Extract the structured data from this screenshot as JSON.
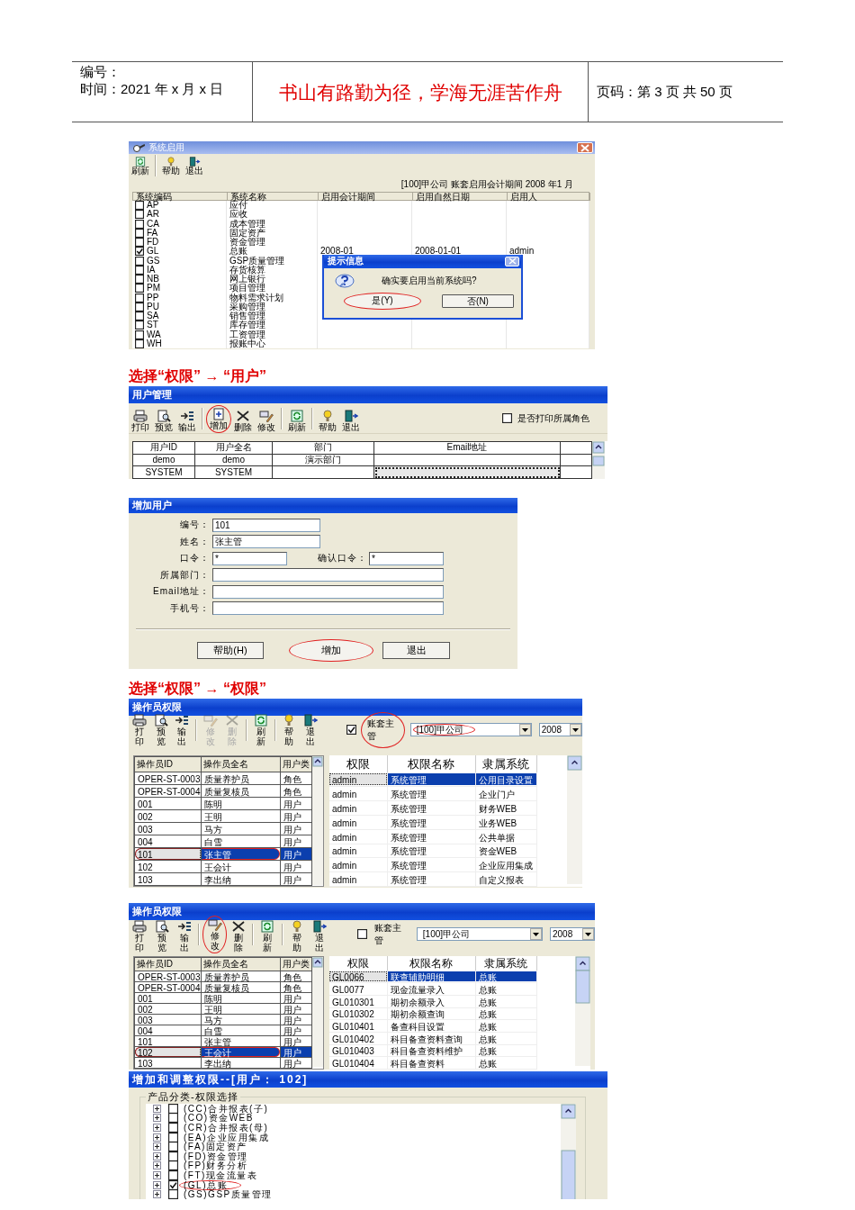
{
  "header": {
    "number_label": "编号：",
    "date": "时间：2021 年 x 月 x 日",
    "motto": "书山有路勤为径，学海无涯苦作舟",
    "page": "页码：第 3 页  共 50 页"
  },
  "system_enable": {
    "title": "系统启用",
    "toolbar": [
      [
        {
          "kind": "refresh",
          "label": "刷新"
        }
      ],
      [
        {
          "kind": "help",
          "label": "帮助"
        },
        {
          "kind": "exit",
          "label": "退出"
        }
      ]
    ],
    "info": "[100]甲公司 账套启用会计期间 2008 年1 月",
    "columns": [
      "系统编码",
      "系统名称",
      "启用会计期间",
      "启用自然日期",
      "启用人"
    ],
    "rows": [
      {
        "code": "AP",
        "name": "应付",
        "checked": false
      },
      {
        "code": "AR",
        "name": "应收",
        "checked": false
      },
      {
        "code": "CA",
        "name": "成本管理",
        "checked": false
      },
      {
        "code": "FA",
        "name": "固定资产",
        "checked": false
      },
      {
        "code": "FD",
        "name": "资金管理",
        "checked": false
      },
      {
        "code": "GL",
        "name": "总账",
        "period": "2008-01",
        "date": "2008-01-01",
        "user": "admin",
        "checked": true
      },
      {
        "code": "GS",
        "name": "GSP质量管理",
        "checked": false
      },
      {
        "code": "IA",
        "name": "存货核算",
        "checked": false
      },
      {
        "code": "NB",
        "name": "网上银行",
        "checked": false
      },
      {
        "code": "PM",
        "name": "项目管理",
        "checked": false
      },
      {
        "code": "PP",
        "name": "物料需求计划",
        "checked": false
      },
      {
        "code": "PU",
        "name": "采购管理",
        "checked": false
      },
      {
        "code": "SA",
        "name": "销售管理",
        "checked": false
      },
      {
        "code": "ST",
        "name": "库存管理",
        "checked": false
      },
      {
        "code": "WA",
        "name": "工资管理",
        "checked": false
      },
      {
        "code": "WH",
        "name": "报账中心",
        "checked": false
      }
    ],
    "dialog": {
      "title": "提示信息",
      "message": "确实要启用当前系统吗?",
      "buttons": [
        {
          "label": "是(Y)",
          "highlighted": true
        },
        {
          "label": "否(N)",
          "highlighted": false
        }
      ]
    }
  },
  "caption_1": "选择“权限” → “用户”",
  "user_management": {
    "title": "用户管理",
    "toolbar": [
      [
        {
          "kind": "print",
          "label": "打印",
          "highlighted": false
        },
        {
          "kind": "preview",
          "label": "预览",
          "highlighted": false
        },
        {
          "kind": "export",
          "label": "输出",
          "highlighted": false
        }
      ],
      [
        {
          "kind": "add",
          "label": "增加",
          "highlighted": true
        },
        {
          "kind": "delete",
          "label": "删除",
          "highlighted": false
        },
        {
          "kind": "edit",
          "label": "修改",
          "highlighted": false
        }
      ],
      [
        {
          "kind": "refresh",
          "label": "刷新",
          "highlighted": false
        }
      ],
      [
        {
          "kind": "help",
          "label": "帮助",
          "highlighted": false
        },
        {
          "kind": "exit",
          "label": "退出",
          "highlighted": false
        }
      ]
    ],
    "print_roles": {
      "label": "是否打印所属角色",
      "checked": false
    },
    "columns": [
      "用户ID",
      "用户全名",
      "部门",
      "Email地址"
    ],
    "rows": [
      {
        "id": "demo",
        "name": "demo",
        "department": "演示部门",
        "selected": false
      },
      {
        "id": "SYSTEM",
        "name": "SYSTEM",
        "selected": true
      }
    ]
  },
  "add_user": {
    "title": "增加用户",
    "fields": [
      {
        "label": "编号：",
        "value": "101",
        "kind": "short"
      },
      {
        "label": "姓名：",
        "value": "张主管",
        "kind": "short"
      },
      {
        "label": "口令：",
        "value": "*",
        "kind": "narrow",
        "pair": {
          "label": "确认口令：",
          "value": "*"
        }
      },
      {
        "label": "所属部门：",
        "kind": "long"
      },
      {
        "label": "Email地址：",
        "kind": "long"
      },
      {
        "label": "手机号：",
        "kind": "long"
      }
    ],
    "buttons": [
      {
        "label": "帮助(H)",
        "highlighted": false
      },
      {
        "label": "增加",
        "highlighted": true
      },
      {
        "label": "退出",
        "highlighted": false
      }
    ]
  },
  "caption_2": "选择“权限” → “权限”",
  "operator_rights_1": {
    "title": "操作员权限",
    "toolbar": [
      [
        {
          "kind": "print",
          "label": "打印",
          "disabled": false
        },
        {
          "kind": "preview",
          "label": "预览",
          "disabled": false
        },
        {
          "kind": "export",
          "label": "输出",
          "disabled": false
        }
      ],
      [
        {
          "kind": "edit",
          "label": "修改",
          "disabled": true
        },
        {
          "kind": "delete",
          "label": "删除",
          "disabled": true
        }
      ],
      [
        {
          "kind": "refresh",
          "label": "刷新",
          "disabled": false
        }
      ],
      [
        {
          "kind": "help",
          "label": "帮助",
          "disabled": false
        },
        {
          "kind": "exit",
          "label": "退出",
          "disabled": false
        }
      ]
    ],
    "account_manager": {
      "label": "账套主管",
      "checked": true,
      "highlighted": true
    },
    "account": {
      "value": "[100]甲公司",
      "highlighted": true
    },
    "year": "2008",
    "user_columns": [
      "操作员ID",
      "操作员全名",
      "用户类"
    ],
    "users": [
      {
        "id": "OPER-ST-0003",
        "name": "质量养护员",
        "type": "角色",
        "selected": false,
        "highlighted": false
      },
      {
        "id": "OPER-ST-0004",
        "name": "质量复核员",
        "type": "角色",
        "selected": false,
        "highlighted": false
      },
      {
        "id": "001",
        "name": "陈明",
        "type": "用户",
        "selected": false,
        "highlighted": false
      },
      {
        "id": "002",
        "name": "王明",
        "type": "用户",
        "selected": false,
        "highlighted": false
      },
      {
        "id": "003",
        "name": "马方",
        "type": "用户",
        "selected": false,
        "highlighted": false
      },
      {
        "id": "004",
        "name": "白雪",
        "type": "用户",
        "selected": false,
        "highlighted": false
      },
      {
        "id": "101",
        "name": "张主管",
        "type": "用户",
        "selected": true,
        "highlighted": true
      },
      {
        "id": "102",
        "name": "王会计",
        "type": "用户",
        "selected": false,
        "highlighted": false
      },
      {
        "id": "103",
        "name": "李出纳",
        "type": "用户",
        "selected": false,
        "highlighted": false
      }
    ],
    "right_columns": [
      "权限",
      "权限名称",
      "隶属系统"
    ],
    "rights": [
      {
        "code": "admin",
        "name": "系统管理",
        "system": "公用目录设置",
        "selected": true
      },
      {
        "code": "admin",
        "name": "系统管理",
        "system": "企业门户",
        "selected": false
      },
      {
        "code": "admin",
        "name": "系统管理",
        "system": "财务WEB",
        "selected": false
      },
      {
        "code": "admin",
        "name": "系统管理",
        "system": "业务WEB",
        "selected": false
      },
      {
        "code": "admin",
        "name": "系统管理",
        "system": "公共单据",
        "selected": false
      },
      {
        "code": "admin",
        "name": "系统管理",
        "system": "资金WEB",
        "selected": false
      },
      {
        "code": "admin",
        "name": "系统管理",
        "system": "企业应用集成",
        "selected": false
      },
      {
        "code": "admin",
        "name": "系统管理",
        "system": "自定义报表",
        "selected": false
      }
    ]
  },
  "operator_rights_2": {
    "title": "操作员权限",
    "toolbar": [
      [
        {
          "kind": "print",
          "label": "打印",
          "disabled": false,
          "highlighted": false
        },
        {
          "kind": "preview",
          "label": "预览",
          "disabled": false,
          "highlighted": false
        },
        {
          "kind": "export",
          "label": "输出",
          "disabled": false,
          "highlighted": false
        }
      ],
      [
        {
          "kind": "edit",
          "label": "修改",
          "disabled": false,
          "highlighted": true
        },
        {
          "kind": "delete",
          "label": "删除",
          "disabled": false,
          "highlighted": false
        }
      ],
      [
        {
          "kind": "refresh",
          "label": "刷新",
          "disabled": false,
          "highlighted": false
        }
      ],
      [
        {
          "kind": "help",
          "label": "帮助",
          "disabled": false,
          "highlighted": false
        },
        {
          "kind": "exit",
          "label": "退出",
          "disabled": false,
          "highlighted": false
        }
      ]
    ],
    "account_manager": {
      "label": "账套主管",
      "checked": false,
      "highlighted": false
    },
    "account": {
      "value": "[100]甲公司",
      "highlighted": false
    },
    "year": "2008",
    "user_columns": [
      "操作员ID",
      "操作员全名",
      "用户类"
    ],
    "users": [
      {
        "id": "OPER-ST-0003",
        "name": "质量养护员",
        "type": "角色",
        "selected": false,
        "highlighted": false
      },
      {
        "id": "OPER-ST-0004",
        "name": "质量复核员",
        "type": "角色",
        "selected": false,
        "highlighted": false
      },
      {
        "id": "001",
        "name": "陈明",
        "type": "用户",
        "selected": false,
        "highlighted": false
      },
      {
        "id": "002",
        "name": "王明",
        "type": "用户",
        "selected": false,
        "highlighted": false
      },
      {
        "id": "003",
        "name": "马方",
        "type": "用户",
        "selected": false,
        "highlighted": false
      },
      {
        "id": "004",
        "name": "白雪",
        "type": "用户",
        "selected": false,
        "highlighted": false
      },
      {
        "id": "101",
        "name": "张主管",
        "type": "用户",
        "selected": false,
        "highlighted": false
      },
      {
        "id": "102",
        "name": "王会计",
        "type": "用户",
        "selected": true,
        "highlighted": true
      },
      {
        "id": "103",
        "name": "李出纳",
        "type": "用户",
        "selected": false,
        "highlighted": false
      }
    ],
    "right_columns": [
      "权限",
      "权限名称",
      "隶属系统"
    ],
    "rights": [
      {
        "code": "GL0066",
        "name": "联查辅助明细",
        "system": "总账",
        "selected": true
      },
      {
        "code": "GL0077",
        "name": "现金流量录入",
        "system": "总账",
        "selected": false
      },
      {
        "code": "GL010301",
        "name": "期初余额录入",
        "system": "总账",
        "selected": false
      },
      {
        "code": "GL010302",
        "name": "期初余额查询",
        "system": "总账",
        "selected": false
      },
      {
        "code": "GL010401",
        "name": "备查科目设置",
        "system": "总账",
        "selected": false
      },
      {
        "code": "GL010402",
        "name": "科目备查资料查询",
        "system": "总账",
        "selected": false
      },
      {
        "code": "GL010403",
        "name": "科目备查资料维护",
        "system": "总账",
        "selected": false
      },
      {
        "code": "GL010404",
        "name": "科目备查资料",
        "system": "总账",
        "selected": false
      }
    ]
  },
  "adjust_rights": {
    "title": "增加和调整权限--[用户： 102]",
    "group_label": "产品分类-权限选择",
    "items": [
      {
        "label": "(CC)合并报表(子)",
        "checked": false,
        "expanded": false,
        "highlighted": false
      },
      {
        "label": "(CO)资金WEB",
        "checked": false,
        "expanded": false,
        "highlighted": false
      },
      {
        "label": "(CR)合并报表(母)",
        "checked": false,
        "expanded": false,
        "highlighted": false
      },
      {
        "label": "(EA)企业应用集成",
        "checked": false,
        "expanded": false,
        "highlighted": false
      },
      {
        "label": "(FA)固定资产",
        "checked": false,
        "expanded": false,
        "highlighted": false
      },
      {
        "label": "(FD)资金管理",
        "checked": false,
        "expanded": false,
        "highlighted": false
      },
      {
        "label": "(FP)财务分析",
        "checked": false,
        "expanded": false,
        "highlighted": false
      },
      {
        "label": "(FT)现金流量表",
        "checked": false,
        "expanded": false,
        "highlighted": false
      },
      {
        "label": "(GL)总账",
        "checked": true,
        "expanded": false,
        "highlighted": true
      },
      {
        "label": "(GS)GSP质量管理",
        "checked": false,
        "expanded": false,
        "highlighted": false
      }
    ]
  }
}
